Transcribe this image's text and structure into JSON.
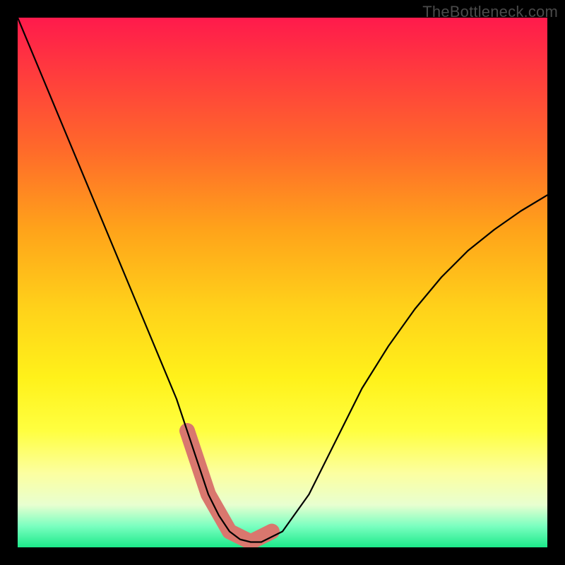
{
  "watermark": "TheBottleneck.com",
  "chart_data": {
    "type": "line",
    "title": "",
    "xlabel": "",
    "ylabel": "",
    "xlim": [
      0,
      100
    ],
    "ylim": [
      0,
      100
    ],
    "series": [
      {
        "name": "bottleneck-curve",
        "x": [
          0,
          5,
          10,
          15,
          20,
          25,
          30,
          32,
          34,
          36,
          38,
          40,
          42,
          44,
          46,
          50,
          55,
          60,
          65,
          70,
          75,
          80,
          85,
          90,
          95,
          100
        ],
        "y": [
          100,
          88,
          76,
          64,
          52,
          40,
          28,
          22,
          16,
          10,
          6,
          3,
          1.5,
          1,
          1,
          3,
          10,
          20,
          30,
          38,
          45,
          51,
          56,
          60,
          63.5,
          66.5
        ]
      },
      {
        "name": "highlight-band",
        "x": [
          32,
          36,
          40,
          44,
          48
        ],
        "y": [
          22,
          10,
          3,
          1,
          3
        ]
      }
    ],
    "annotations": []
  },
  "colors": {
    "curve": "#000000",
    "highlight": "#d9776e",
    "frame": "#000000"
  }
}
